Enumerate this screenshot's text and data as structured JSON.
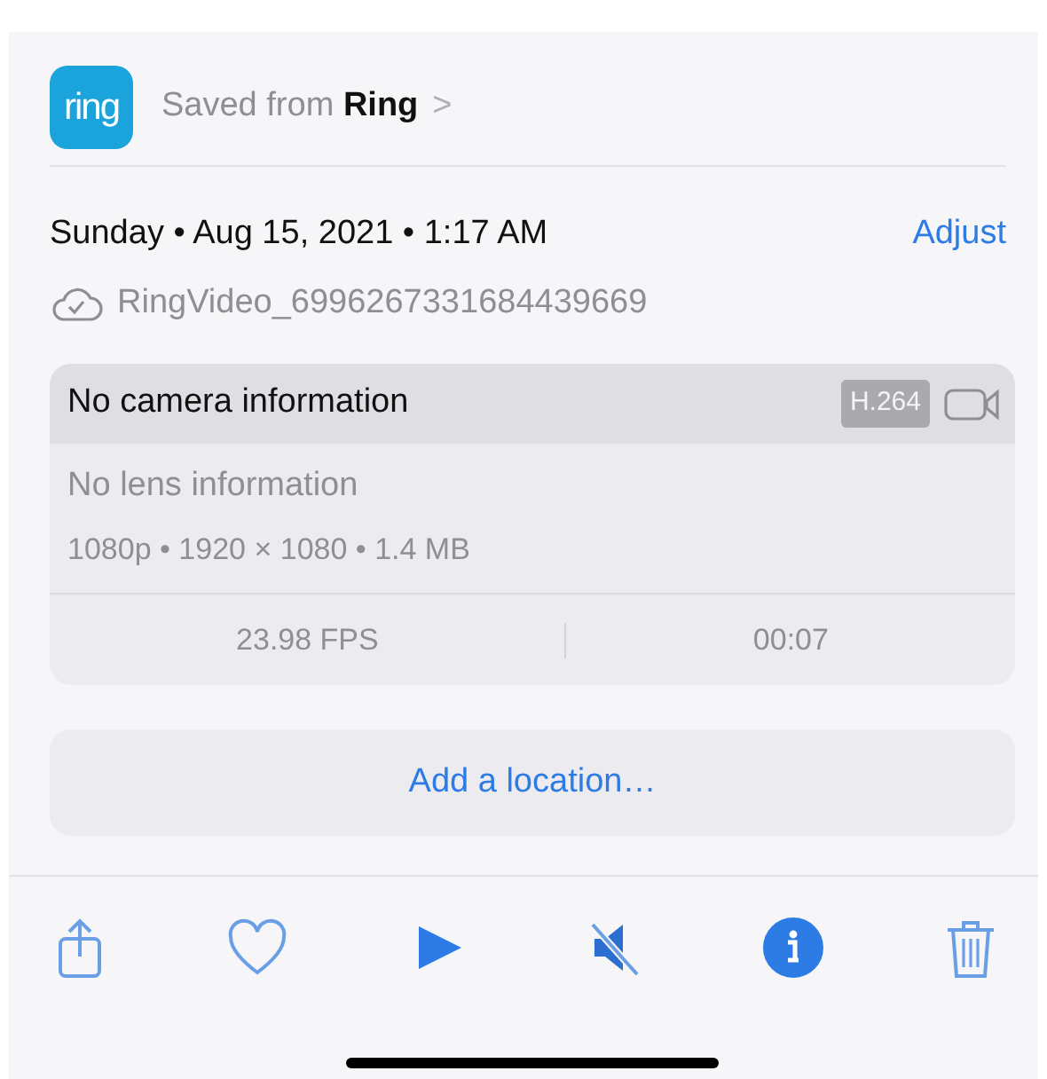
{
  "source": {
    "app_icon_text": "ring",
    "text": "Saved from **Ring**",
    "chevron": ">"
  },
  "date": {
    "text": "Sunday • Aug 15, 2021 • 1:17 AM",
    "action": "Adjust"
  },
  "file": {
    "name": "RingVideo_6996267331684439669",
    "synced": true
  },
  "media_card": {
    "camera": "No camera information",
    "codec": "H.264",
    "lens": "No lens information",
    "specs": "1080p • 1920 × 1080 • 1.4 MB",
    "stats": [
      "23.98 FPS",
      "00:07"
    ]
  },
  "location_button": "Add a location…",
  "toolbar": [
    {
      "kind": "share",
      "selected": false
    },
    {
      "kind": "favorite",
      "selected": false
    },
    {
      "kind": "play",
      "selected": false
    },
    {
      "kind": "mute",
      "selected": false
    },
    {
      "kind": "info",
      "selected": true
    },
    {
      "kind": "delete",
      "selected": false
    }
  ]
}
